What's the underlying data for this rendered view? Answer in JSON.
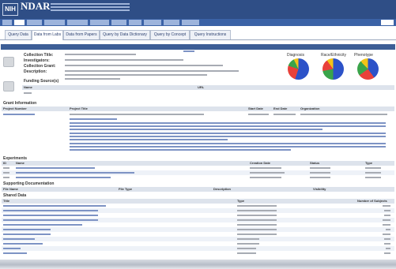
{
  "header": {
    "logo_text": "NIH",
    "brand": "NDAR",
    "brand_subtitle": "…"
  },
  "navbar": {
    "items": [
      "…",
      "…",
      "…",
      "…",
      "…",
      "…",
      "…",
      "…",
      "…",
      "…",
      "…"
    ],
    "right": "…"
  },
  "tabs": [
    {
      "label": "Query Data"
    },
    {
      "label": "Data from Labs"
    },
    {
      "label": "Data from Papers"
    },
    {
      "label": "Query by Data Dictionary"
    },
    {
      "label": "Query by Concept"
    },
    {
      "label": "Query Instructions"
    }
  ],
  "collection": {
    "banner": "…",
    "fields": [
      {
        "label": "Collection Title:"
      },
      {
        "label": "Investigators:"
      },
      {
        "label": "Collection Grant:"
      },
      {
        "label": "Description:"
      }
    ],
    "charts": [
      {
        "name": "Diagnosis",
        "colors": [
          "#2c52c8",
          "#e8413a",
          "#3aa44a",
          "#f2c318"
        ]
      },
      {
        "name": "Race/Ethnicity",
        "colors": [
          "#2c52c8",
          "#3aa44a",
          "#e8413a",
          "#f2c318"
        ]
      },
      {
        "name": "Phenotype",
        "colors": [
          "#2c52c8",
          "#e8413a",
          "#3aa44a",
          "#f2c318"
        ]
      }
    ]
  },
  "sections": {
    "funding": {
      "title": "Funding Source(s)",
      "col1": "Name",
      "col2": "URL"
    },
    "grants": {
      "title": "Grant Information",
      "cols": [
        "Project Number",
        "Project Title",
        "Start Date",
        "End Date",
        "Organization"
      ]
    },
    "experiments": {
      "title": "Experiments",
      "cols": [
        "ID",
        "Name",
        "Creation Date",
        "Status",
        "Type"
      ]
    },
    "supporting_docs": {
      "title": "Supporting Documentation",
      "cols": [
        "File Name",
        "File Type",
        "Description",
        "Visibility"
      ]
    },
    "shared_data": {
      "title": "Shared Data",
      "cols": [
        "Title",
        "Type",
        "Number of Subjects"
      ]
    }
  }
}
